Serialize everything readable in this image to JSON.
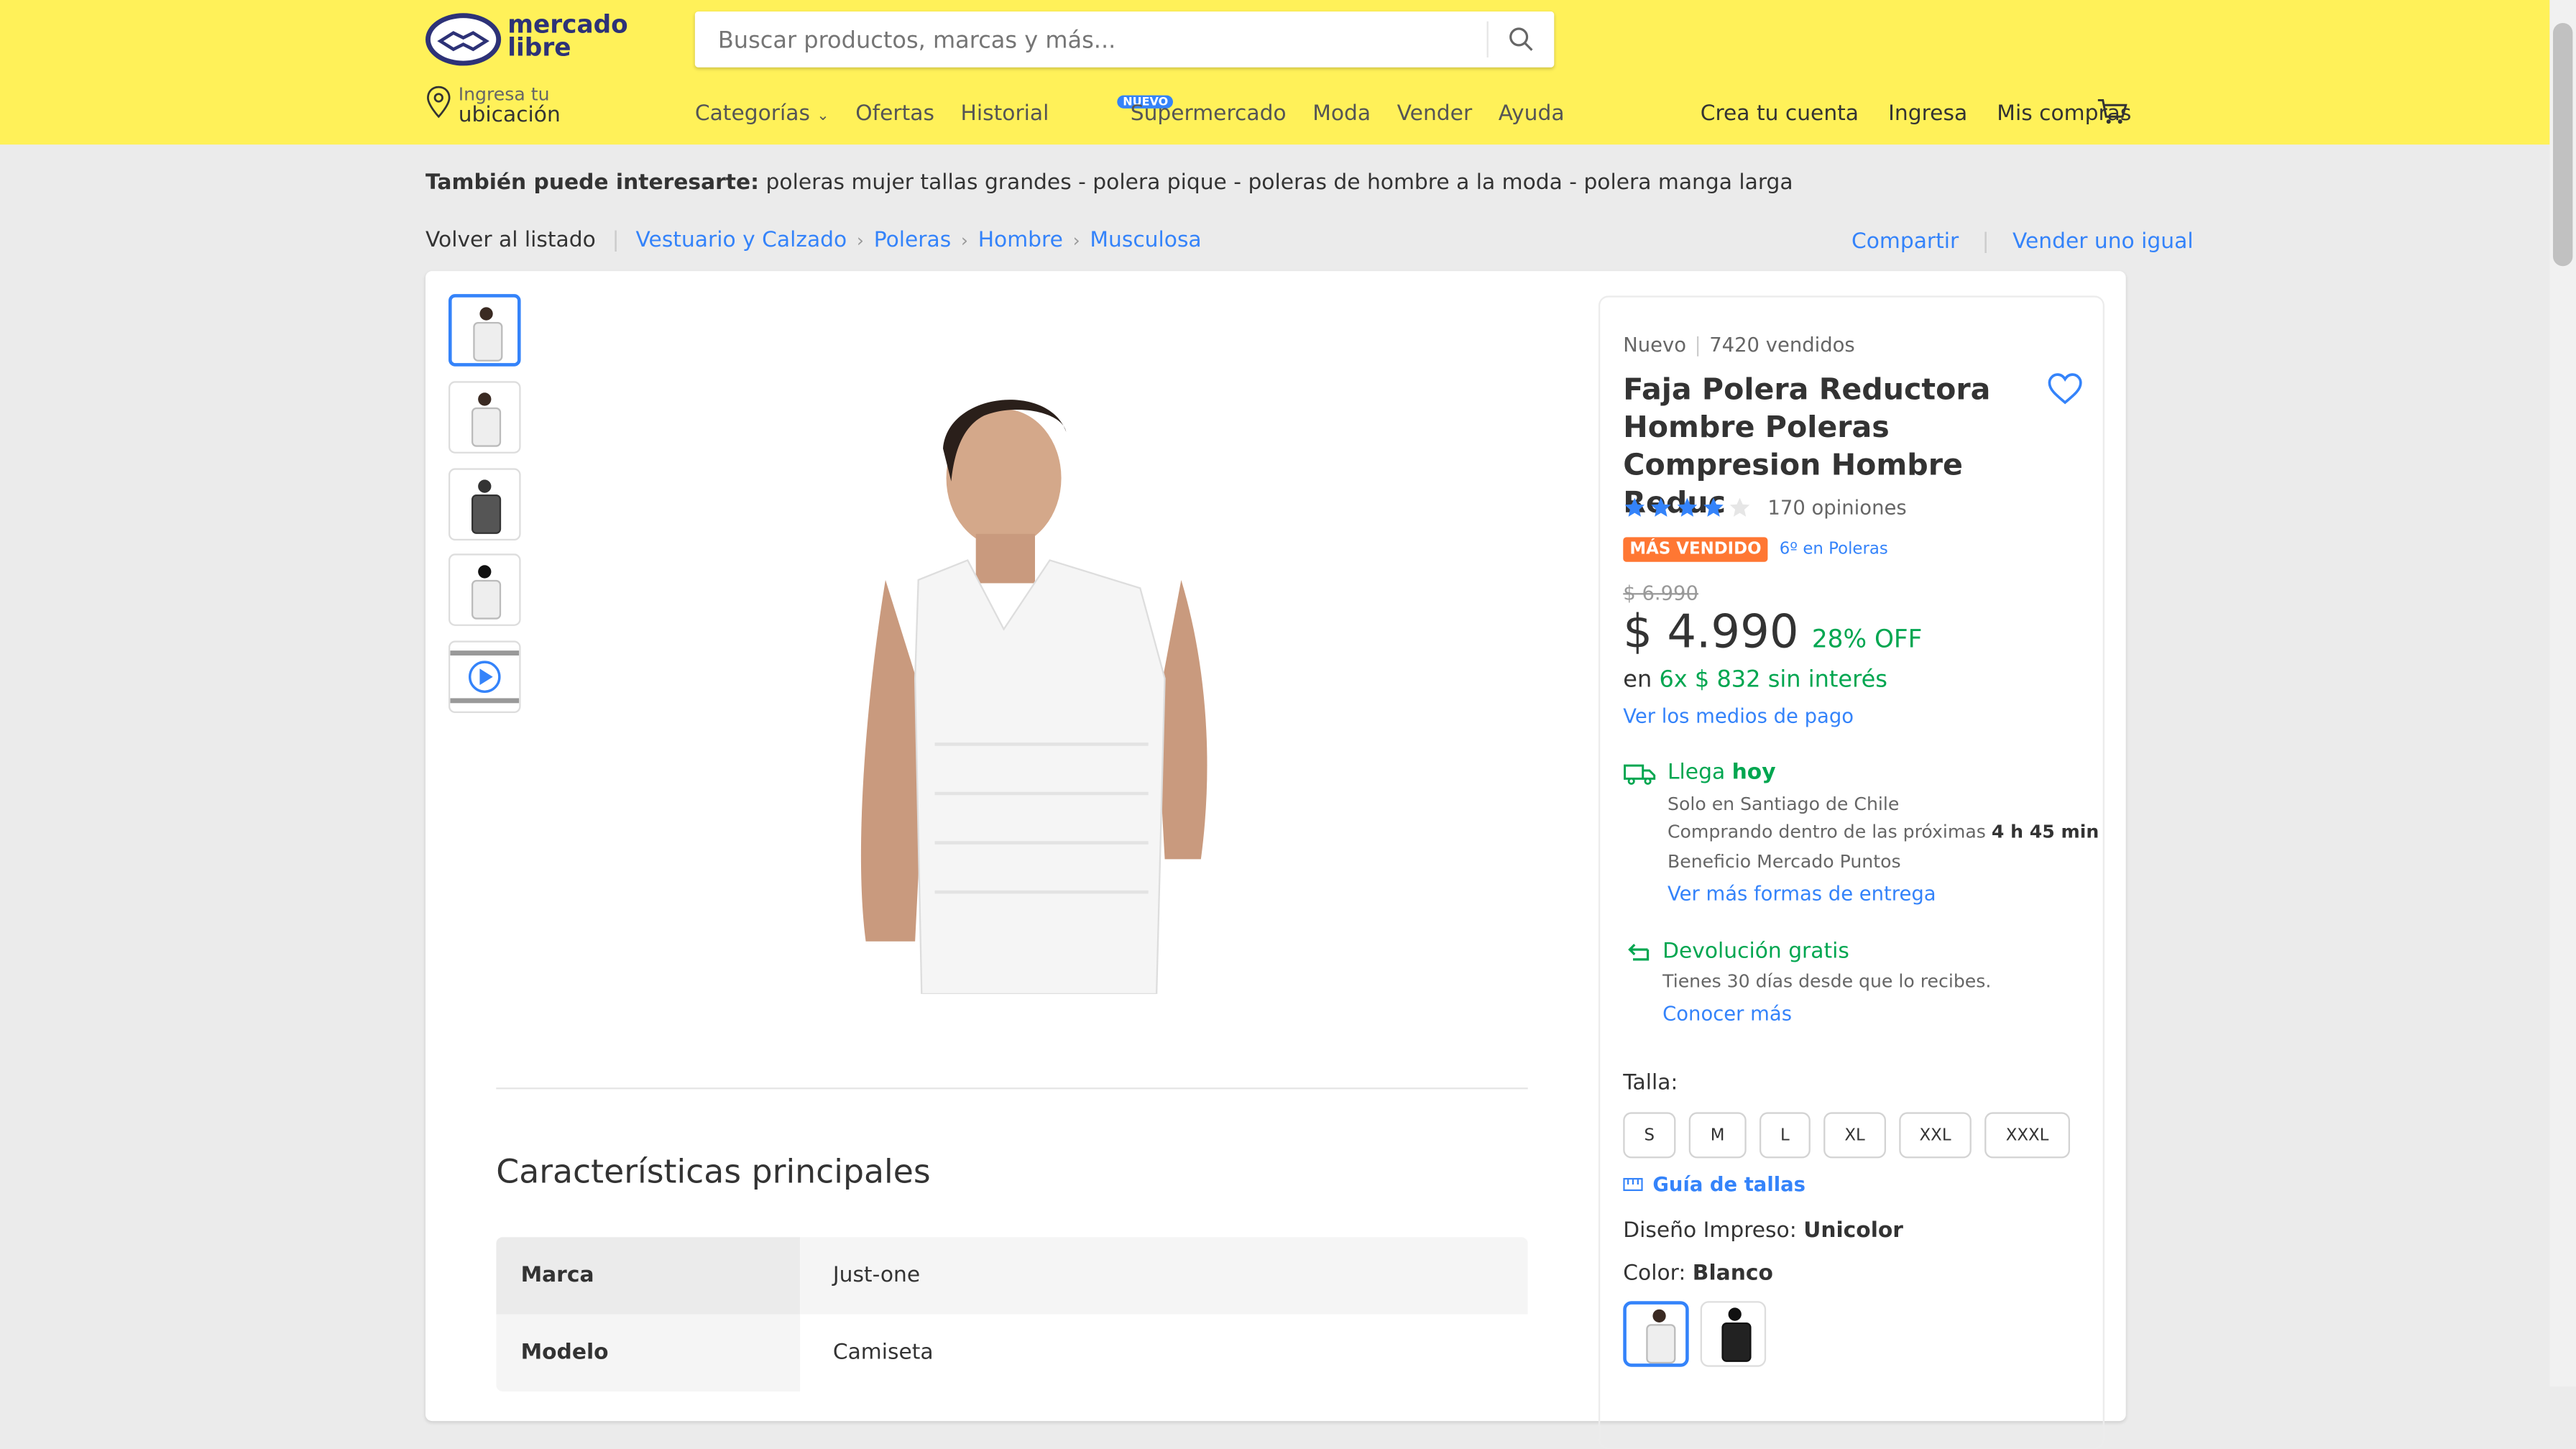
{
  "brand": {
    "name": "mercado libre",
    "color": "#fff159",
    "accent": "#3483fa"
  },
  "search": {
    "placeholder": "Buscar productos, marcas y más..."
  },
  "location": {
    "line1": "Ingresa tu",
    "line2": "ubicación"
  },
  "nav": {
    "categories": "Categorías",
    "offers": "Ofertas",
    "history": "Historial",
    "supermarket": "Supermercado",
    "supermarket_badge": "NUEVO",
    "fashion": "Moda",
    "sell": "Vender",
    "help": "Ayuda"
  },
  "user_nav": {
    "create": "Crea tu cuenta",
    "login": "Ingresa",
    "purchases": "Mis compras"
  },
  "also_interest": {
    "label": "También puede interesarte:",
    "items": "poleras mujer tallas grandes - polera pique - poleras de hombre a la moda - polera manga larga"
  },
  "breadcrumb": {
    "back": "Volver al listado",
    "items": [
      "Vestuario y Calzado",
      "Poleras",
      "Hombre",
      "Musculosa"
    ]
  },
  "actions": {
    "share": "Compartir",
    "sell_same": "Vender uno igual"
  },
  "product": {
    "condition": "Nuevo",
    "sold": "7420 vendidos",
    "title": "Faja Polera Reductora Hombre Poleras Compresion Hombre Reduc",
    "rating": 4,
    "reviews": "170 opiniones",
    "best_seller": "MÁS VENDIDO",
    "rank": "6º en Poleras",
    "old_price": "$ 6.990",
    "price": "$ 4.990",
    "discount": "28% OFF",
    "installments_prefix": "en",
    "installments": "6x $ 832 sin interés",
    "payment_link": "Ver los medios de pago"
  },
  "shipping": {
    "title_prefix": "Llega",
    "title_strong": "hoy",
    "line1": "Solo en Santiago de Chile",
    "line2_prefix": "Comprando dentro de las próximas",
    "line2_time": "4 h 45 min",
    "line3": "Beneficio Mercado Puntos",
    "link": "Ver más formas de entrega"
  },
  "returns": {
    "title": "Devolución gratis",
    "sub": "Tienes 30 días desde que lo recibes.",
    "link": "Conocer más"
  },
  "size": {
    "label": "Talla:",
    "options": [
      "S",
      "M",
      "L",
      "XL",
      "XXL",
      "XXXL"
    ],
    "guide": "Guía de tallas"
  },
  "design": {
    "label": "Diseño Impreso:",
    "value": "Unicolor"
  },
  "color": {
    "label": "Color:",
    "value": "Blanco"
  },
  "features": {
    "title": "Características principales",
    "rows": [
      {
        "key": "Marca",
        "value": "Just-one"
      },
      {
        "key": "Modelo",
        "value": "Camiseta"
      }
    ]
  }
}
